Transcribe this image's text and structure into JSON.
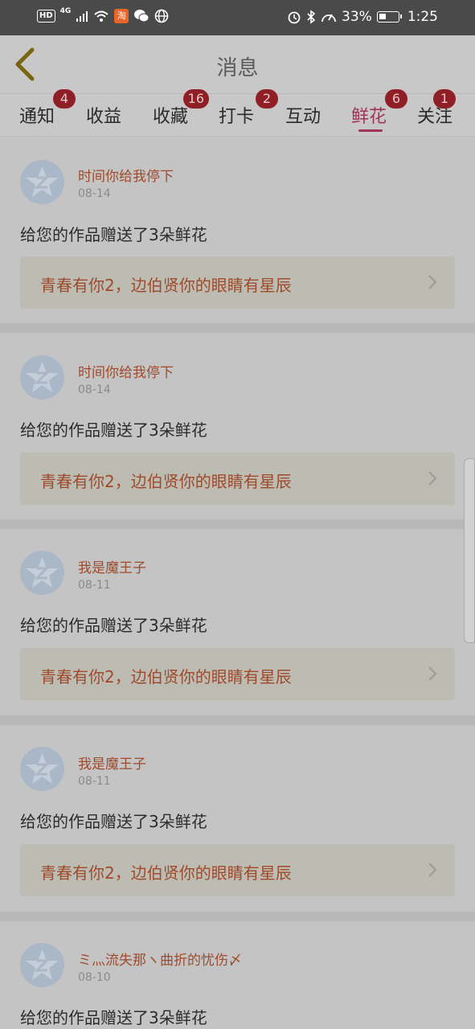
{
  "status_bar": {
    "hd": "HD",
    "network": "4G",
    "taobao_label": "淘",
    "battery_percent": "33%",
    "time": "1:25",
    "icons": [
      "signal-icon",
      "wifi-icon",
      "taobao-icon",
      "wechat-icon",
      "globe-icon",
      "alarm-icon",
      "bluetooth-icon",
      "speed-icon",
      "battery-icon"
    ]
  },
  "header": {
    "title": "消息",
    "back_icon": "chevron-left-icon"
  },
  "tabs": [
    {
      "label": "通知",
      "badge": "4"
    },
    {
      "label": "收益",
      "badge": ""
    },
    {
      "label": "收藏",
      "badge": "16"
    },
    {
      "label": "打卡",
      "badge": "2"
    },
    {
      "label": "互动",
      "badge": ""
    },
    {
      "label": "鲜花",
      "badge": "6",
      "active": true
    },
    {
      "label": "关注",
      "badge": "1"
    }
  ],
  "messages": [
    {
      "sender": "时间你给我停下",
      "date": "08-14",
      "text": "给您的作品赠送了3朵鲜花",
      "work": "青春有你2，边伯贤你的眼睛有星辰"
    },
    {
      "sender": "时间你给我停下",
      "date": "08-14",
      "text": "给您的作品赠送了3朵鲜花",
      "work": "青春有你2，边伯贤你的眼睛有星辰"
    },
    {
      "sender": "我是魔王子",
      "date": "08-11",
      "text": "给您的作品赠送了3朵鲜花",
      "work": "青春有你2，边伯贤你的眼睛有星辰"
    },
    {
      "sender": "我是魔王子",
      "date": "08-11",
      "text": "给您的作品赠送了3朵鲜花",
      "work": "青春有你2，边伯贤你的眼睛有星辰"
    },
    {
      "sender": "ミ灬流失那ヽ曲折的忧伤〆",
      "date": "08-10",
      "text": "给您的作品赠送了3朵鲜花",
      "work": ""
    }
  ],
  "colors": {
    "accent": "#a0345a",
    "badge": "#8f1e26",
    "sender": "#a04a2c"
  }
}
